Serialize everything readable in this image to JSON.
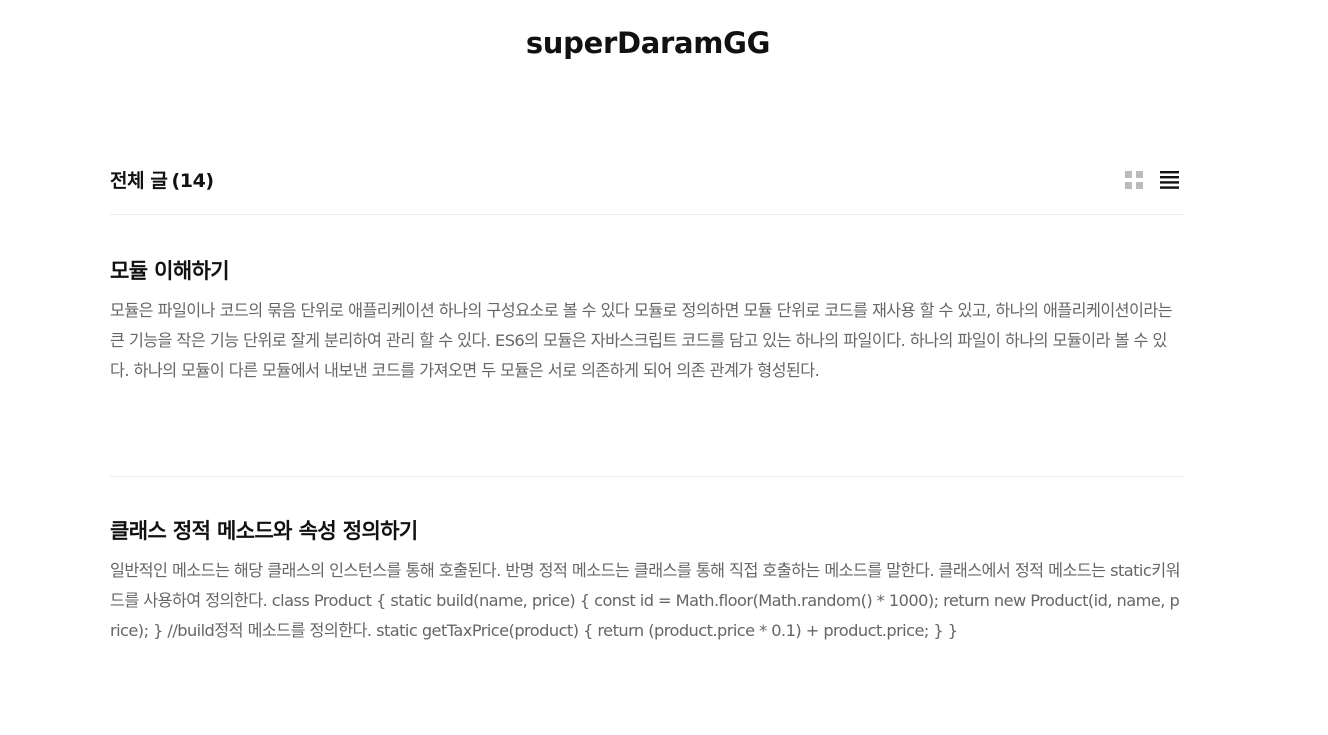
{
  "blog": {
    "title": "superDaramGG"
  },
  "list": {
    "heading": "전체 글",
    "count": "(14)",
    "view_icons": [
      "grid-view-icon",
      "list-view-icon"
    ],
    "active_view": "list"
  },
  "colors": {
    "title": "#111111",
    "excerpt": "#666666",
    "divider": "#ebebeb",
    "icon_inactive": "#bbbbbb",
    "icon_active": "#111111"
  },
  "posts": [
    {
      "title": "모듈 이해하기",
      "excerpt": "모듈은 파일이나 코드의 묶음 단위로 애플리케이션 하나의 구성요소로 볼 수 있다 모듈로 정의하면 모듈 단위로 코드를 재사용 할 수 있고, 하나의 애플리케이션이라는 큰 기능을 작은 기능 단위로 잘게 분리하여 관리 할 수 있다. ES6의 모듈은 자바스크립트 코드를 담고 있는 하나의 파일이다. 하나의 파일이 하나의 모듈이라 볼 수 있다. 하나의 모듈이 다른 모듈에서 내보낸 코드를 가져오면 두 모듈은 서로 의존하게 되어 의존 관계가 형성된다."
    },
    {
      "title": "클래스 정적 메소드와 속성 정의하기",
      "excerpt": "일반적인 메소드는 해당 클래스의 인스턴스를 통해 호출된다. 반명 정적 메소드는 클래스를 통해 직접 호출하는 메소드를 말한다. 클래스에서 정적 메소드는 static키워드를 사용하여 정의한다. class Product { static build(name, price) { const id = Math.floor(Math.random() * 1000); return new Product(id, name, price); } //build정적 메소드를 정의한다. static getTaxPrice(product) { return (product.price * 0.1) + product.price; } }"
    }
  ]
}
